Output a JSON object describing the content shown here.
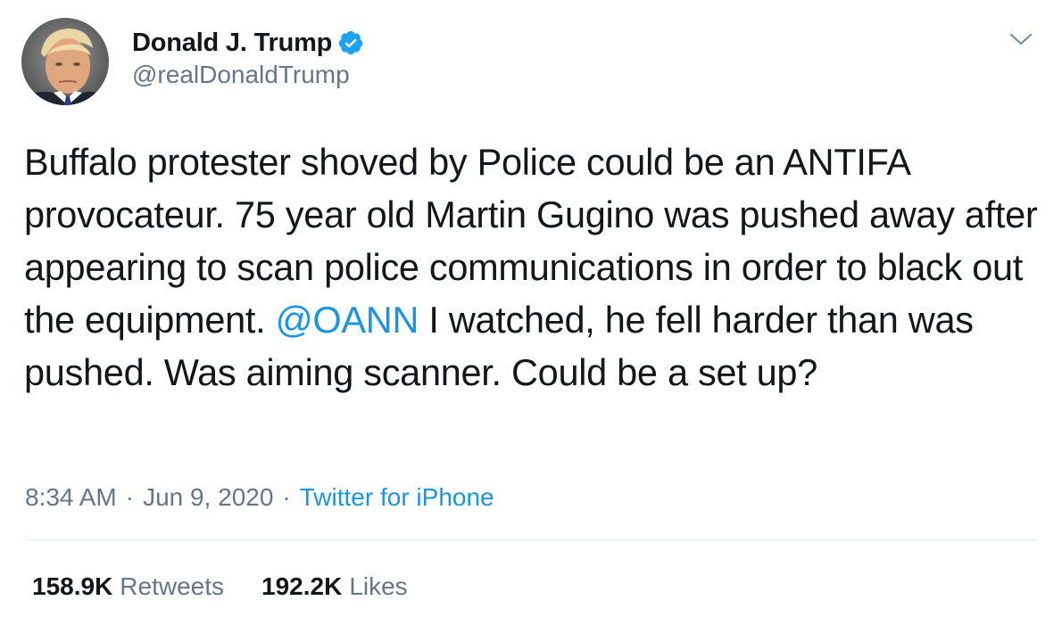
{
  "author": {
    "display_name": "Donald J. Trump",
    "handle": "@realDonaldTrump",
    "verified": true
  },
  "icons": {
    "verified": "verified-badge-icon",
    "menu": "chevron-down-icon"
  },
  "tweet": {
    "text_before": "Buffalo protester shoved by Police could be an ANTIFA provocateur. 75 year old Martin Gugino was pushed away after appearing to scan police communications in order to black out the equipment. ",
    "mention": "@OANN",
    "text_after": "  I watched, he fell harder than was pushed. Was aiming scanner. Could be a set up?"
  },
  "meta": {
    "time": "8:34 AM",
    "separator": "·",
    "date": "Jun 9, 2020",
    "source": "Twitter for iPhone"
  },
  "stats": {
    "retweets_count": "158.9K",
    "retweets_label": "Retweets",
    "likes_count": "192.2K",
    "likes_label": "Likes"
  },
  "colors": {
    "text": "#14171a",
    "secondary": "#657786",
    "link": "#1b95e0",
    "verified": "#1da1f2",
    "divider": "#e1e8ed"
  }
}
